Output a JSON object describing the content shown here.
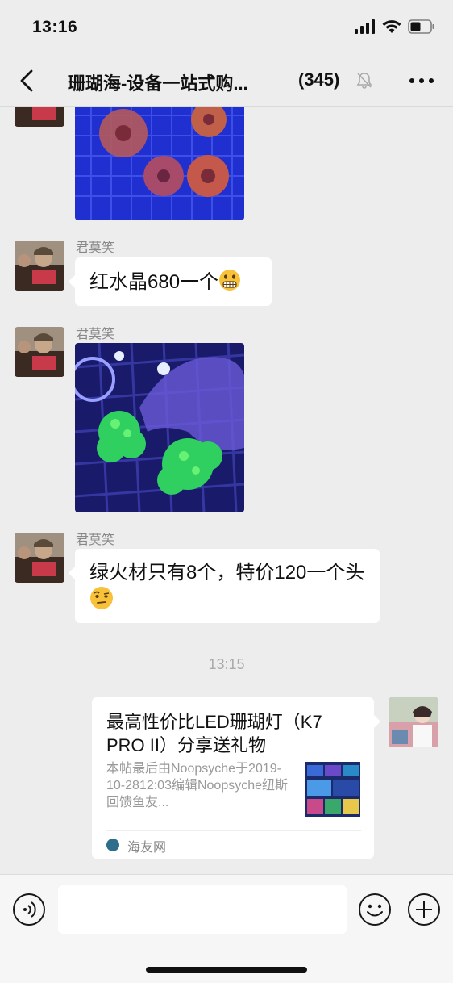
{
  "status_bar": {
    "time": "13:16"
  },
  "nav": {
    "title": "珊瑚海-设备一站式购...",
    "member_count": "(345)"
  },
  "messages": [
    {
      "sender": "君莫笑",
      "text": "红水晶680一个",
      "emoji": "grimacing-face-emoji"
    },
    {
      "sender": "君莫笑",
      "image": "green-coral-photo"
    },
    {
      "sender": "君莫笑",
      "text": "绿火材只有8个，特价120一个头",
      "emoji": "face-with-raised-eyebrow-emoji"
    }
  ],
  "timestamp": "13:15",
  "link_card": {
    "title": "最高性价比LED珊瑚灯（K7 PRO II）分享送礼物",
    "description": "本帖最后由Noopsyche于2019-10-2812:03编辑Noopsyche纽斯回馈鱼友...",
    "source": "海友网"
  },
  "input": {
    "placeholder": ""
  },
  "colors": {
    "background": "#ededed",
    "bubble": "#ffffff",
    "meta_text": "#888888"
  }
}
